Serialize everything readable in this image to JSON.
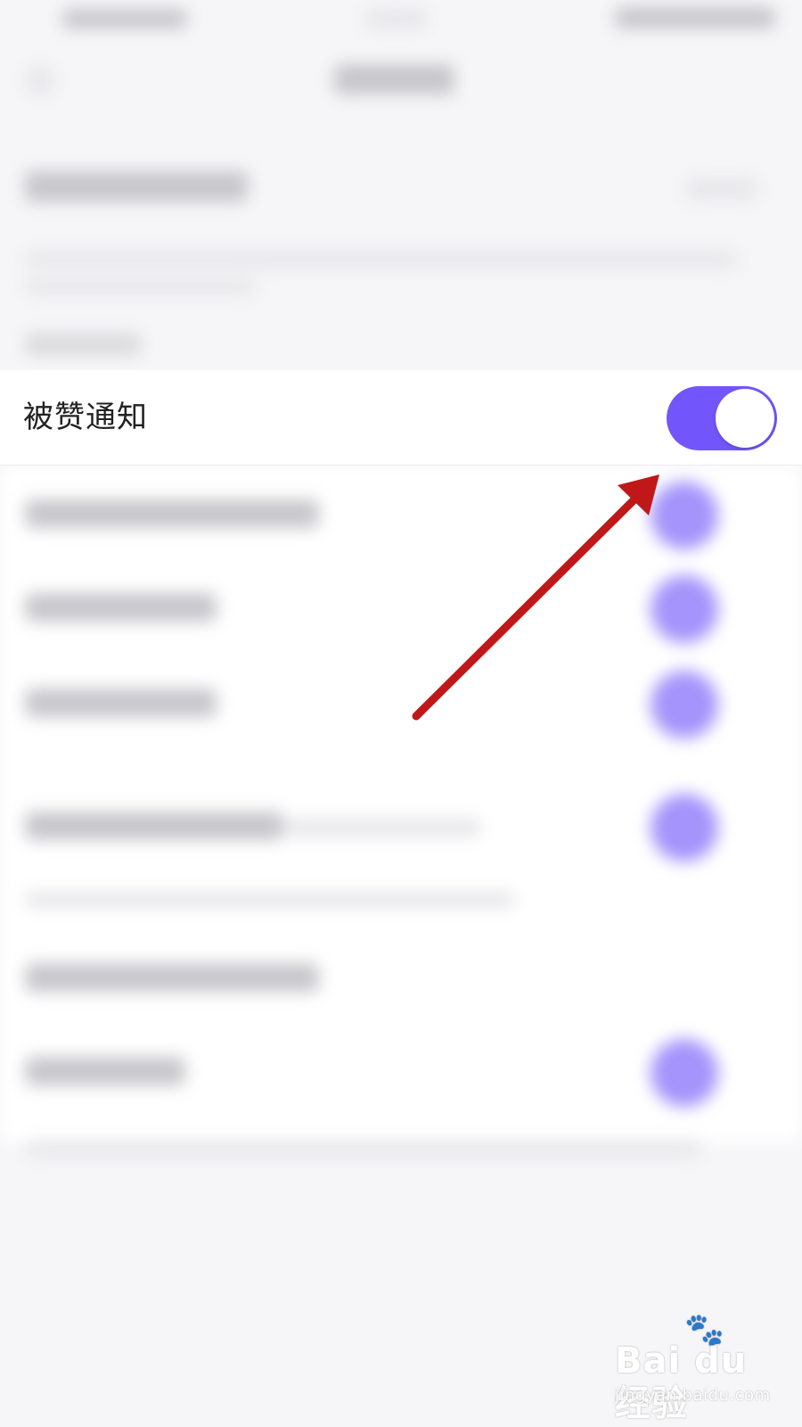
{
  "setting_row": {
    "label": "被赞通知",
    "enabled": true,
    "toggle_color": "#7356fb"
  },
  "annotation": {
    "arrow_color": "#c01818"
  },
  "watermark": {
    "brand": "Bai du 经验",
    "subtitle": "jingyan.baidu.com",
    "icon": "paw-icon"
  },
  "colors": {
    "background": "#f6f6f8",
    "toggle_on": "#7356fb",
    "text": "#222222"
  }
}
